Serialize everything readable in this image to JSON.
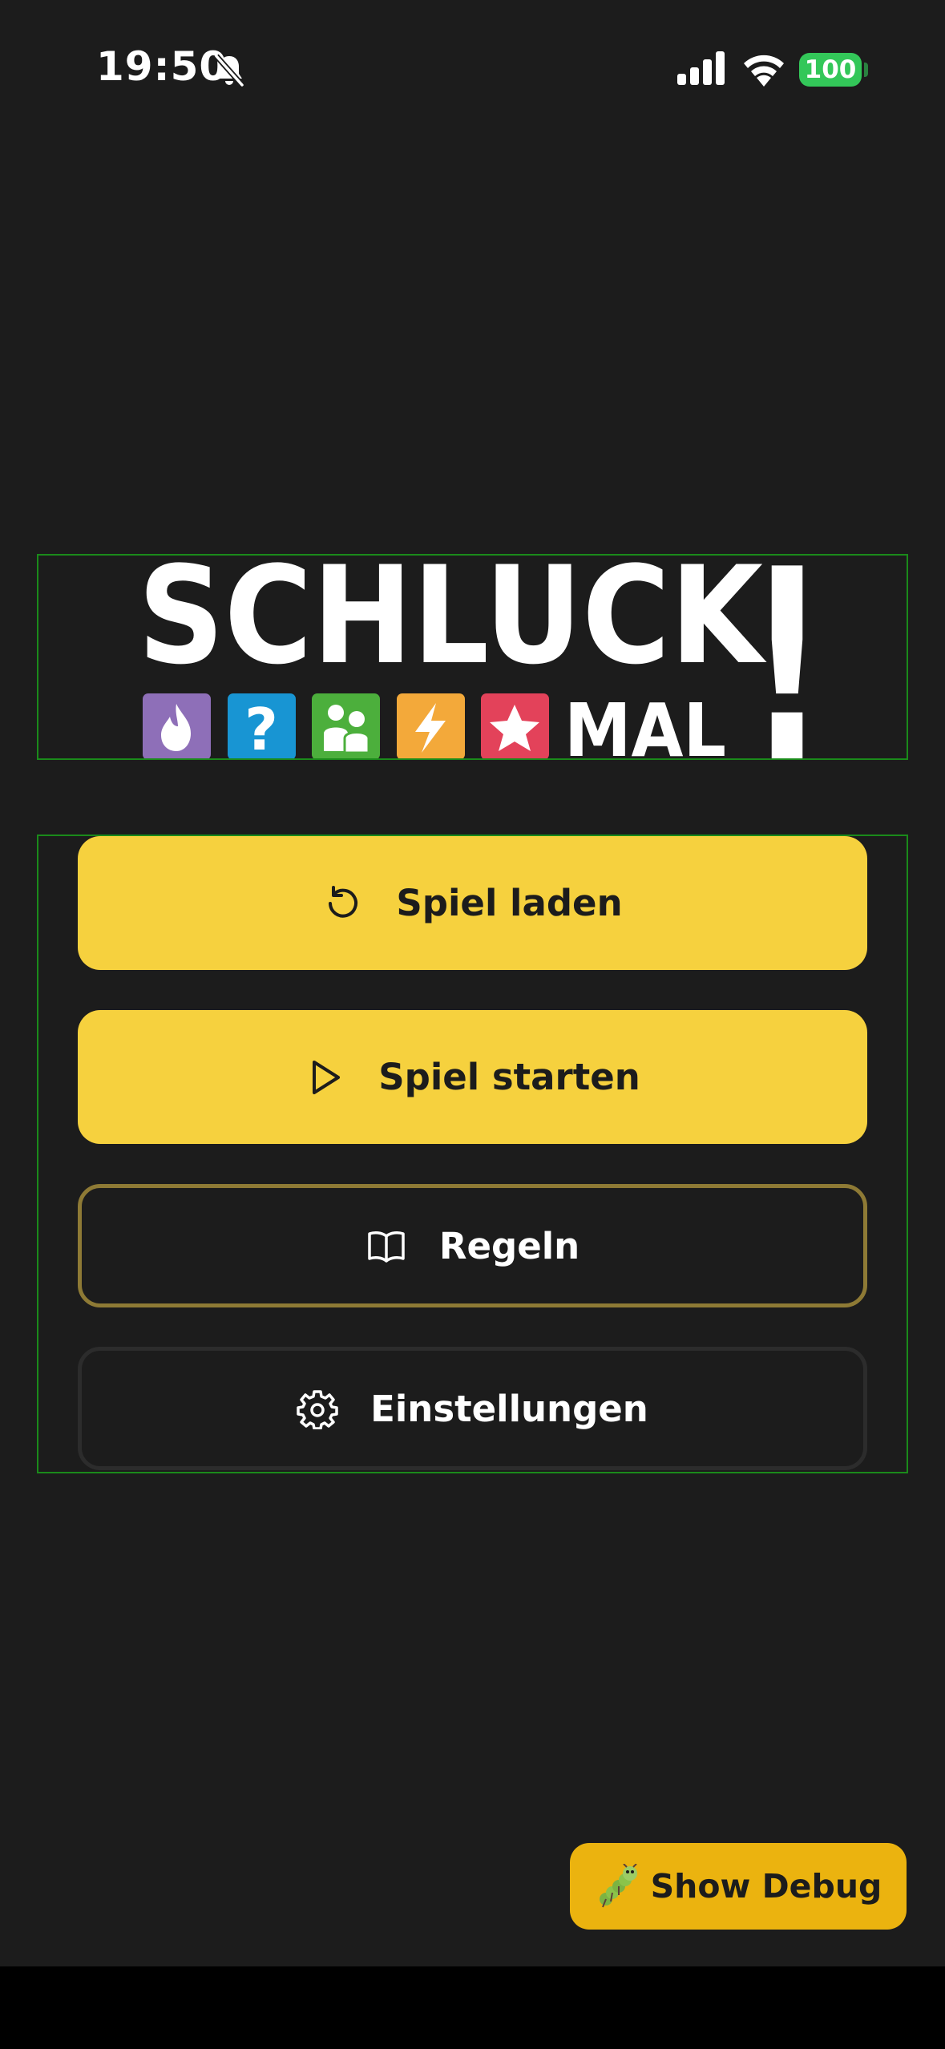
{
  "status_bar": {
    "time": "19:50",
    "battery": "100",
    "icons": [
      "bell-off-icon",
      "signal-icon",
      "wifi-icon",
      "battery-icon"
    ]
  },
  "logo": {
    "title": "SCHLUCK",
    "exclamation": "!",
    "subtitle": "MAL",
    "tiles": [
      {
        "icon": "flame-icon",
        "color": "#8e6fb8"
      },
      {
        "icon": "question-icon",
        "color": "#1895d3"
      },
      {
        "icon": "people-icon",
        "color": "#4caf3c"
      },
      {
        "icon": "lightning-icon",
        "color": "#f3a93a"
      },
      {
        "icon": "star-icon",
        "color": "#e3425a"
      }
    ]
  },
  "menu": {
    "load_label": "Spiel laden",
    "start_label": "Spiel starten",
    "rules_label": "Regeln",
    "settings_label": "Einstellungen"
  },
  "debug": {
    "label": "Show Debug",
    "icon": "caterpillar-icon"
  },
  "colors": {
    "background": "#1c1c1c",
    "primary": "#f6d13e",
    "rules_border": "#8e7a35",
    "debug": "#ebb30f",
    "battery": "#33c759"
  }
}
